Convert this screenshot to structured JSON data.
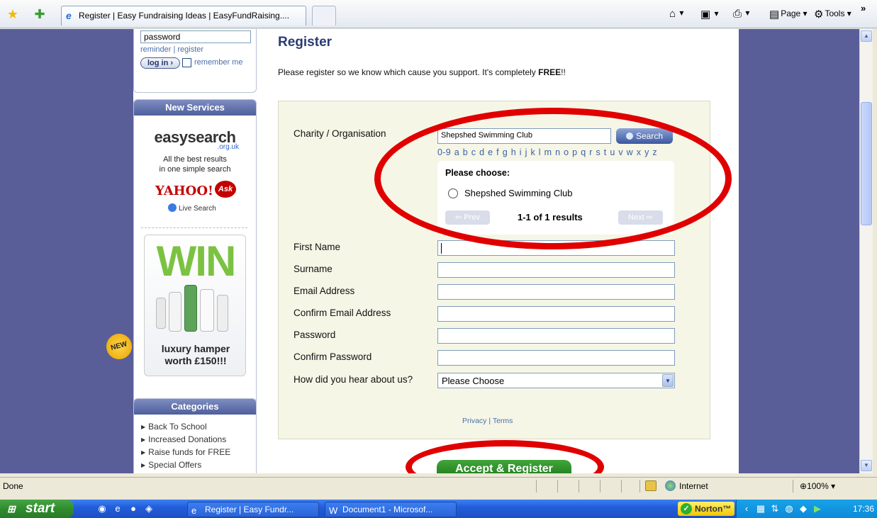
{
  "browser": {
    "tab_title": "Register | Easy Fundraising Ideas | EasyFundRaising....",
    "commands": {
      "page": "Page",
      "tools": "Tools"
    },
    "status": "Done",
    "zone": "Internet",
    "zoom": "100%"
  },
  "sidebar": {
    "login": {
      "password_value": "password",
      "links": "reminder | register",
      "login_label": "log in",
      "remember_label": "remember me"
    },
    "services": {
      "heading": "New Services",
      "easysearch_logo": "easysearch",
      "easysearch_domain": ".org.uk",
      "easysearch_line1": "All the best results",
      "easysearch_line2": "in one simple search",
      "yahoo": "YAHOO!",
      "ask": "Ask",
      "live_search": "Live Search",
      "win": "WIN",
      "hamper_line1": "luxury hamper",
      "hamper_line2": "worth £150!!!",
      "new_badge": "NEW"
    },
    "categories": {
      "heading": "Categories",
      "items": [
        "Back To School",
        "Increased Donations",
        "Raise funds for FREE",
        "Special Offers"
      ]
    }
  },
  "main": {
    "title": "Register",
    "intro": "Please register so we know which cause you support.  It's completely ",
    "intro_bold": "FREE",
    "intro_end": "!!",
    "form": {
      "charity_label": "Charity / Organisation",
      "charity_value": "Shepshed Swimming Club",
      "search_label": "Search",
      "alphabet": "0-9 a b c d e f g h i j k l m n o p q r s t u v w x y z",
      "please_choose": "Please choose:",
      "result_option": "Shepshed Swimming Club",
      "prev_label": "⇦ Prev",
      "next_label": "Next ⇨",
      "results_count": "1-1 of 1 results",
      "first_name_label": "First Name",
      "surname_label": "Surname",
      "email_label": "Email Address",
      "confirm_email_label": "Confirm Email Address",
      "password_label": "Password",
      "confirm_password_label": "Confirm Password",
      "hear_label": "How did you hear about us?",
      "hear_selected": "Please Choose",
      "privacy": "Privacy",
      "terms": "Terms",
      "accept_label": "Accept & Register"
    }
  },
  "taskbar": {
    "start_label": "start",
    "tasks": [
      "Register | Easy Fundr...",
      "Document1 - Microsof..."
    ],
    "norton": "Norton™",
    "clock": "17:36"
  }
}
